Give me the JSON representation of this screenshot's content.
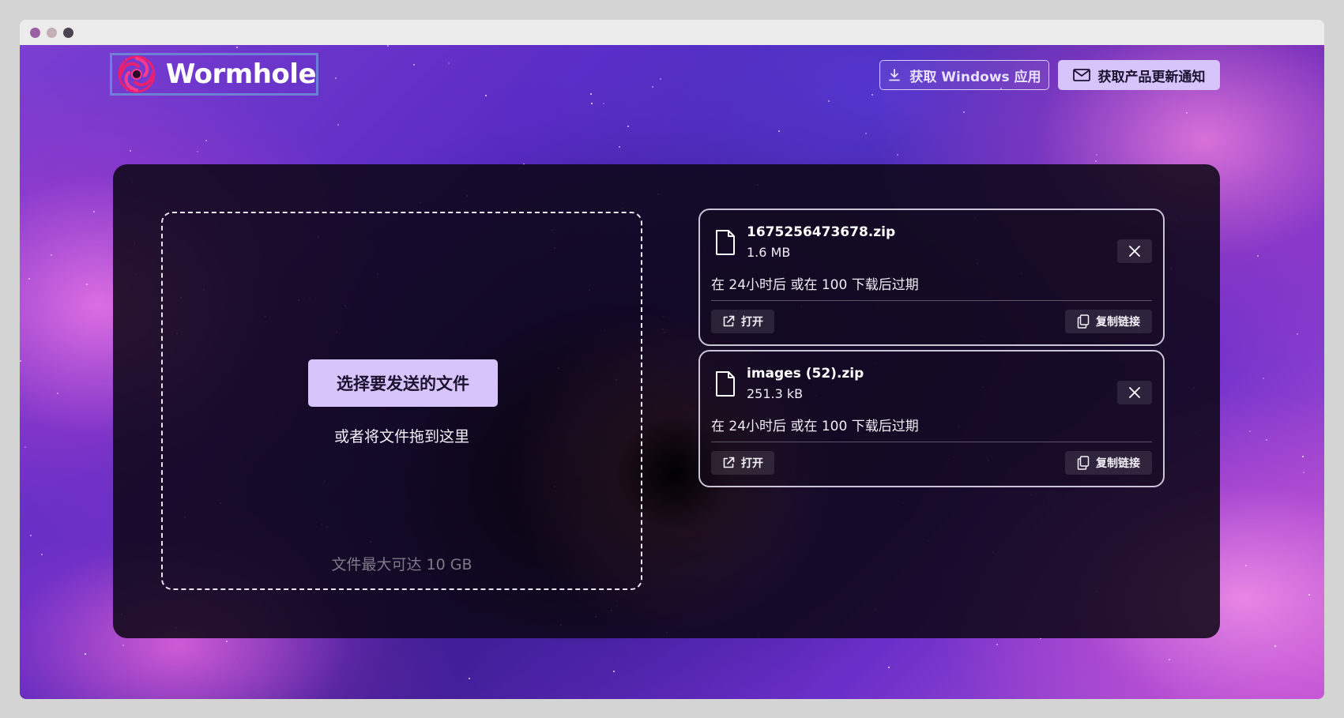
{
  "window": {
    "traffic_lights": [
      "#9b5fa3",
      "#c4b0b4",
      "#4a4450"
    ]
  },
  "header": {
    "logo_text": "Wormhole",
    "windows_button": "获取 Windows 应用",
    "notify_button": "获取产品更新通知"
  },
  "upload": {
    "choose_button": "选择要发送的文件",
    "drag_hint": "或者将文件拖到这里",
    "max_size": "文件最大可达 10 GB"
  },
  "files": [
    {
      "name": "1675256473678.zip",
      "size": "1.6 MB",
      "expiry": "在 24小时后 或在 100 下载后过期",
      "open_label": "打开",
      "copy_label": "复制链接"
    },
    {
      "name": "images (52).zip",
      "size": "251.3 kB",
      "expiry": "在 24小时后 或在 100 下载后过期",
      "open_label": "打开",
      "copy_label": "复制链接"
    }
  ],
  "colors": {
    "accent": "#d6c4fb",
    "panel": "#0c0614",
    "logo_border": "#6e7fd6"
  }
}
